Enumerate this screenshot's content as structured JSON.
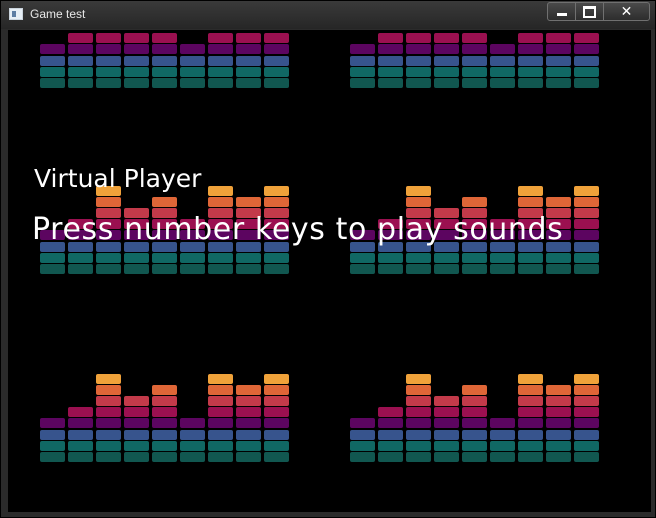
{
  "window": {
    "title": "Game test",
    "icon": "app-window-icon",
    "controls": {
      "minimize_icon": "minimize-icon",
      "maximize_icon": "maximize-icon",
      "close_label": "✕"
    }
  },
  "game": {
    "player_label": "Virtual Player",
    "instructions": "Press number keys to play sounds",
    "equalizer_colors": [
      "#115750",
      "#106864",
      "#37548d",
      "#5c0560",
      "#9b1050",
      "#c33a4a",
      "#df6637",
      "#f0a23a"
    ],
    "equalizers": [
      {
        "name": "equalizer-top-left",
        "levels": [
          4,
          5,
          5,
          5,
          5,
          4,
          5,
          5,
          5
        ]
      },
      {
        "name": "equalizer-top-right",
        "levels": [
          4,
          5,
          5,
          5,
          5,
          4,
          5,
          5,
          5
        ]
      },
      {
        "name": "equalizer-middle-left",
        "levels": [
          4,
          5,
          8,
          6,
          7,
          5,
          8,
          7,
          8
        ]
      },
      {
        "name": "equalizer-middle-right",
        "levels": [
          4,
          5,
          8,
          6,
          7,
          5,
          8,
          7,
          8
        ]
      },
      {
        "name": "equalizer-bottom-left",
        "levels": [
          4,
          5,
          8,
          6,
          7,
          4,
          8,
          7,
          8
        ]
      },
      {
        "name": "equalizer-bottom-right",
        "levels": [
          4,
          5,
          8,
          6,
          7,
          4,
          8,
          7,
          8
        ]
      }
    ]
  }
}
